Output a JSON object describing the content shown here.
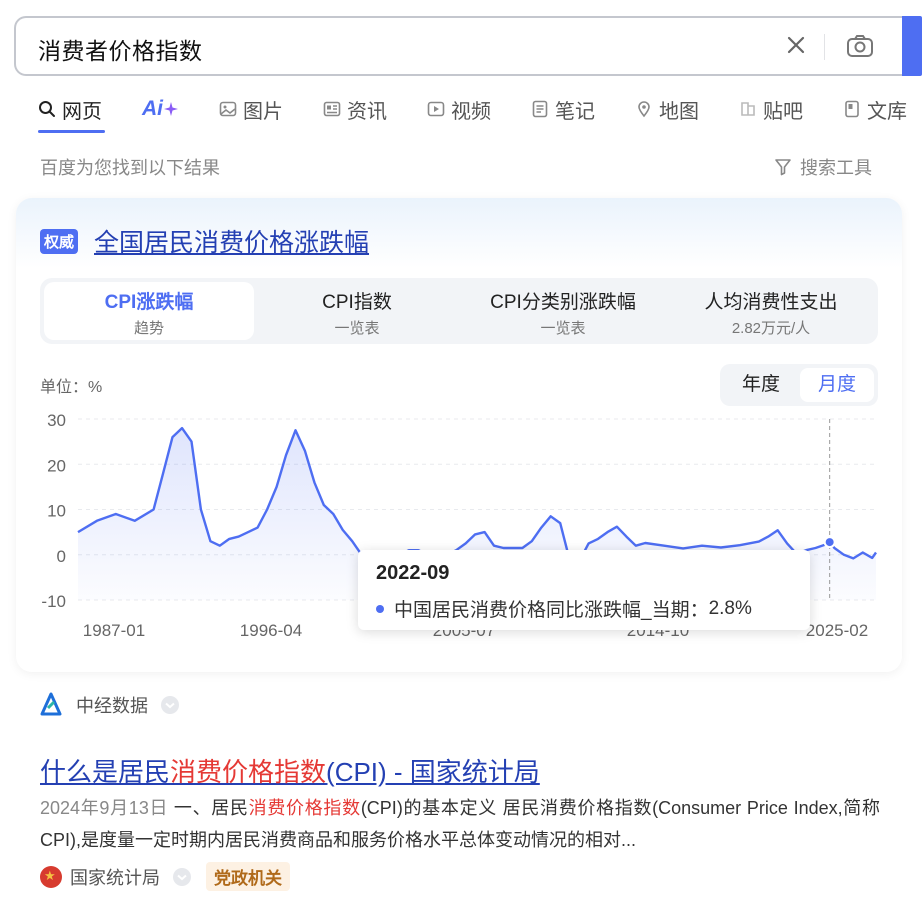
{
  "search": {
    "query": "消费者价格指数"
  },
  "tabs": [
    {
      "label": "网页",
      "icon": "search-icon"
    },
    {
      "label": "",
      "icon": "ai-icon",
      "ai_text": "Ai"
    },
    {
      "label": "图片",
      "icon": "image-icon"
    },
    {
      "label": "资讯",
      "icon": "news-icon"
    },
    {
      "label": "视频",
      "icon": "video-icon"
    },
    {
      "label": "笔记",
      "icon": "note-icon"
    },
    {
      "label": "地图",
      "icon": "map-icon"
    },
    {
      "label": "贴吧",
      "icon": "tieba-icon"
    },
    {
      "label": "文库",
      "icon": "doc-icon"
    }
  ],
  "result_count": "百度为您找到以下结果",
  "search_tools": "搜索工具",
  "card": {
    "badge": "权威",
    "title": "全国居民消费价格涨跌幅",
    "subtabs": [
      {
        "main": "CPI涨跌幅",
        "sub": "趋势"
      },
      {
        "main": "CPI指数",
        "sub": "一览表"
      },
      {
        "main": "CPI分类别涨跌幅",
        "sub": "一览表"
      },
      {
        "main": "人均消费性支出",
        "sub": "2.82万元/人"
      }
    ],
    "unit": "单位：%",
    "period": {
      "year": "年度",
      "month": "月度"
    },
    "tooltip": {
      "date": "2022-09",
      "series": "中国居民消费价格同比涨跌幅_当期：",
      "value": "2.8%"
    }
  },
  "chart_data": {
    "type": "area",
    "series": [
      {
        "name": "中国居民消费价格同比涨跌幅_当期"
      }
    ],
    "x": [
      1983.0,
      1984.0,
      1985.0,
      1986.0,
      1987.0,
      1987.5,
      1988.0,
      1988.5,
      1989.0,
      1989.5,
      1990.0,
      1990.5,
      1991.0,
      1991.5,
      1992.0,
      1992.5,
      1993.0,
      1993.5,
      1994.0,
      1994.5,
      1995.0,
      1995.5,
      1996.0,
      1996.5,
      1997.0,
      1997.5,
      1998.0,
      1998.5,
      1999.0,
      1999.5,
      2000.0,
      2000.5,
      2001.0,
      2001.5,
      2002.0,
      2002.5,
      2003.0,
      2003.5,
      2004.0,
      2004.5,
      2005.0,
      2005.5,
      2006.0,
      2006.5,
      2007.0,
      2007.5,
      2008.0,
      2008.5,
      2009.0,
      2009.5,
      2010.0,
      2010.5,
      2011.0,
      2011.5,
      2012.0,
      2012.5,
      2013.0,
      2014.0,
      2015.0,
      2016.0,
      2017.0,
      2018.0,
      2019.0,
      2019.5,
      2020.0,
      2020.5,
      2021.0,
      2021.5,
      2022.0,
      2022.5,
      2022.75,
      2023.0,
      2023.5,
      2024.0,
      2024.5,
      2025.0,
      2025.2
    ],
    "y": [
      5.0,
      7.5,
      9.0,
      7.5,
      10.0,
      18.0,
      26.0,
      28.0,
      25.0,
      10.0,
      3.0,
      2.0,
      3.5,
      4.0,
      5.0,
      6.0,
      10.0,
      15.0,
      22.0,
      27.5,
      23.0,
      16.0,
      11.0,
      9.0,
      5.5,
      3.0,
      0.0,
      -1.2,
      -2.0,
      -1.0,
      0.0,
      1.0,
      1.0,
      0.0,
      -1.0,
      0.0,
      1.0,
      2.5,
      4.5,
      5.0,
      2.0,
      1.5,
      1.5,
      1.5,
      3.0,
      6.0,
      8.5,
      7.0,
      -1.2,
      -1.5,
      2.5,
      3.5,
      5.0,
      6.2,
      4.0,
      2.0,
      2.6,
      2.0,
      1.4,
      2.0,
      1.6,
      2.1,
      2.9,
      4.0,
      5.4,
      2.5,
      0.2,
      1.0,
      1.5,
      2.2,
      2.8,
      1.5,
      0.0,
      -0.8,
      0.5,
      -0.7,
      0.5
    ],
    "x_tick_labels": [
      "1987-01",
      "1996-04",
      "2005-07",
      "2014-10",
      "2025-02"
    ],
    "y_ticks": [
      30,
      20,
      10,
      0,
      -10
    ],
    "ylim": [
      -10,
      30
    ],
    "xlim": [
      1983.0,
      2025.2
    ],
    "highlight_x": 2022.75,
    "colors": {
      "line": "#4e6ef2"
    },
    "grid": true
  },
  "source1": "中经数据",
  "result2": {
    "title_pre": "什么是居民",
    "title_hl": "消费价格指数",
    "title_post": "(CPI) - 国家统计局",
    "date": "2024年9月13日",
    "snippet_pre": " 一、居民",
    "snippet_hl": "消费价格指数",
    "snippet_post": "(CPI)的基本定义 居民消费价格指数(Consumer Price Index,简称CPI),是度量一定时期内居民消费商品和服务价格水平总体变动情况的相对...",
    "source": "国家统计局",
    "badge": "党政机关"
  }
}
